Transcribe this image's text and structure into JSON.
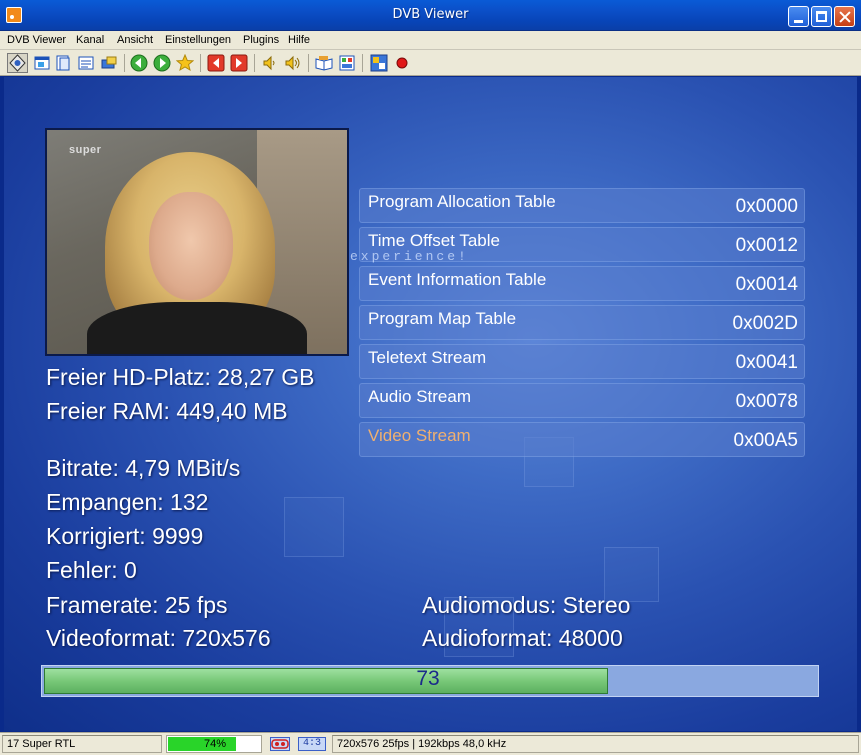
{
  "window": {
    "title": "DVB Viewer"
  },
  "menu": [
    "DVB Viewer",
    "Kanal",
    "Ansicht",
    "Einstellungen",
    "Plugins",
    "Hilfe"
  ],
  "toolbar_icons": [
    "osd-icon",
    "window-icon",
    "epg-icon",
    "teletext-icon",
    "recorder-icon",
    "back-icon",
    "forward-icon",
    "favorites-icon",
    "prev-channel-icon",
    "next-channel-icon",
    "volume-down-icon",
    "volume-up-icon",
    "guide-book-icon",
    "picture-settings-icon",
    "options-icon",
    "record-icon"
  ],
  "thumbnail": {
    "channel_logo": "super"
  },
  "info": {
    "free_hd": "Freier HD-Platz: 28,27 GB",
    "free_ram": "Freier RAM: 449,40 MB",
    "bitrate": "Bitrate: 4,79 MBit/s",
    "received": "Empangen: 132",
    "corrected": "Korrigiert: 9999",
    "errors": "Fehler: 0",
    "framerate": "Framerate: 25 fps",
    "videoformat": "Videoformat: 720x576",
    "audiomode": "Audiomodus: Stereo",
    "audioformat": "Audioformat: 48000"
  },
  "watermark": "experience!",
  "pid_table": [
    {
      "name": "Program Allocation Table",
      "value": "0x0000",
      "active": false
    },
    {
      "name": "Time Offset Table",
      "value": "0x0012",
      "active": false
    },
    {
      "name": "Event Information Table",
      "value": "0x0014",
      "active": false
    },
    {
      "name": "Program Map Table",
      "value": "0x002D",
      "active": false
    },
    {
      "name": "Teletext Stream",
      "value": "0x0041",
      "active": false
    },
    {
      "name": "Audio Stream",
      "value": "0x0078",
      "active": false
    },
    {
      "name": "Video Stream",
      "value": "0x00A5",
      "active": true
    }
  ],
  "signal": {
    "value": 73,
    "label": "73"
  },
  "statusbar": {
    "channel": "17 Super RTL",
    "progress_percent": 74,
    "progress_label": "74%",
    "aspect": "4:3",
    "stream_info": "720x576 25fps | 192kbps 48,0 kHz"
  },
  "colors": {
    "accent_active_pid": "#f0b070",
    "signal_fill": "#78c878",
    "status_progress": "#29d429"
  }
}
